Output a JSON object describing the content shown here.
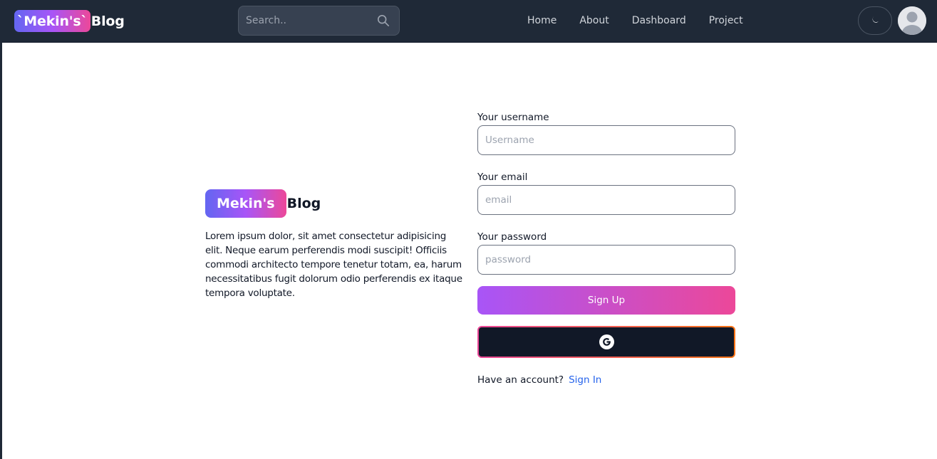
{
  "navbar": {
    "brand_badge": "`Mekin's`",
    "brand_text": "Blog",
    "search": {
      "placeholder": "Search.."
    },
    "links": [
      {
        "label": "Home"
      },
      {
        "label": "About"
      },
      {
        "label": "Dashboard"
      },
      {
        "label": "Project"
      }
    ]
  },
  "hero": {
    "badge": "Mekin's",
    "text": "Blog",
    "description": "Lorem ipsum dolor, sit amet consectetur adipisicing elit. Neque earum perferendis modi suscipit! Officiis commodi architecto tempore tenetur totam, ea, harum necessitatibus fugit dolorum odio perferendis ex itaque tempora voluptate."
  },
  "form": {
    "username": {
      "label": "Your username",
      "placeholder": "Username"
    },
    "email": {
      "label": "Your email",
      "placeholder": "email"
    },
    "password": {
      "label": "Your password",
      "placeholder": "password"
    },
    "signup_label": "Sign Up",
    "google_icon": "google-icon",
    "account_prompt": "Have an account?",
    "signin_label": "Sign In"
  },
  "colors": {
    "navbar_bg": "#1f2937",
    "gradient_start": "#a855f7",
    "gradient_end": "#ec4899",
    "link": "#2563eb"
  }
}
